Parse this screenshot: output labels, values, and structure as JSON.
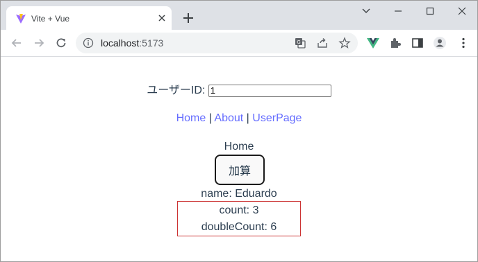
{
  "browser": {
    "tab_title": "Vite + Vue",
    "url_host": "localhost",
    "url_port": ":5173"
  },
  "page": {
    "user_id_label": "ユーザーID:",
    "user_id_value": "1",
    "nav": {
      "home": "Home",
      "sep1": " | ",
      "about": "About",
      "sep2": " | ",
      "userpage": "UserPage"
    },
    "view_title": "Home",
    "calc_button": "加算",
    "name_label": "name: Eduardo",
    "count_label": "count: 3",
    "double_count_label": "doubleCount: 6"
  },
  "colors": {
    "link": "#646cff",
    "text": "#2c3e50",
    "counter_border": "#cc3333"
  }
}
